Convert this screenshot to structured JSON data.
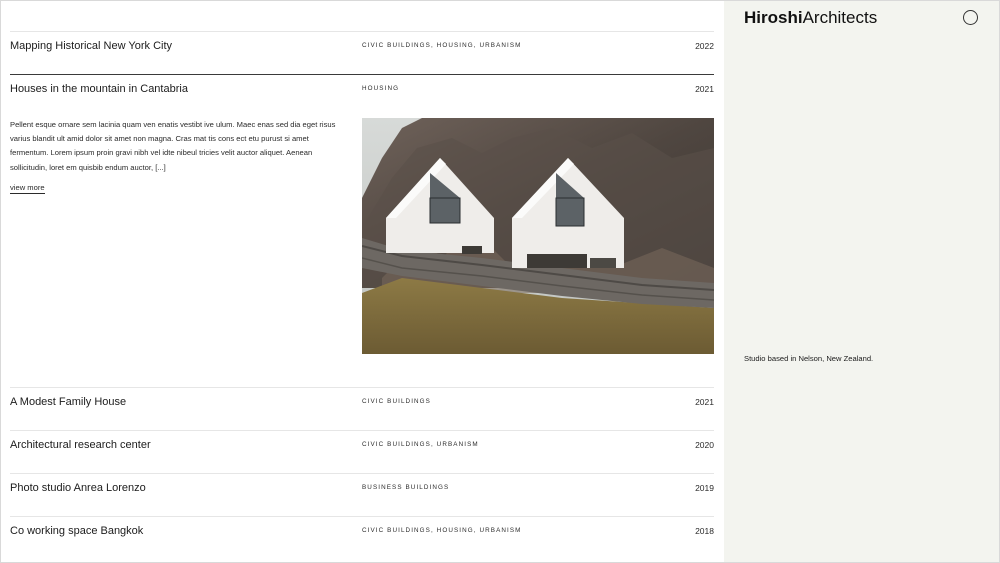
{
  "brand": {
    "bold": "Hiroshi",
    "regular": "Architects"
  },
  "sidebar": {
    "studio_text": "Studio based in Nelson, New Zealand."
  },
  "projects": [
    {
      "title": "Mapping Historical New York City",
      "tags": "CIVIC BUILDINGS, HOUSING, URBANISM",
      "year": "2022"
    },
    {
      "title": "Houses in the mountain in Cantabria",
      "tags": "HOUSING",
      "year": "2021"
    },
    {
      "title": "A Modest Family House",
      "tags": "CIVIC BUILDINGS",
      "year": "2021"
    },
    {
      "title": "Architectural research center",
      "tags": "CIVIC BUILDINGS, URBANISM",
      "year": "2020"
    },
    {
      "title": "Photo studio Anrea Lorenzo",
      "tags": "BUSINESS BUILDINGS",
      "year": "2019"
    },
    {
      "title": "Co working space Bangkok",
      "tags": "CIVIC BUILDINGS, HOUSING, URBANISM",
      "year": "2018"
    }
  ],
  "expanded": {
    "description": "Pellent esque ornare sem lacinia quam ven enatis vestibt ive ulum. Maec enas sed dia eget risus varius blandit ult amid dolor sit amet non magna. Cras mat tis cons ect etu purust si amet fermentum. Lorem ipsum proin gravi nibh vel idte nibeul tricies velit auctor aliquet. Aenean sollicitudin, loret em quisbib endum auctor, [...]",
    "view_more": "view more"
  }
}
